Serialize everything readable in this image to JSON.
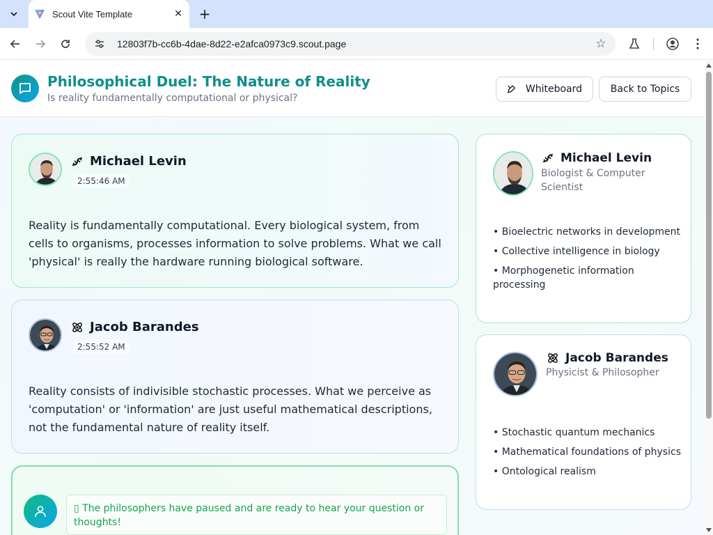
{
  "browser": {
    "tab_title": "Scout Vite Template",
    "url": "12803f7b-cc6b-4dae-8d22-e2afca0973c9.scout.page"
  },
  "header": {
    "title": "Philosophical Duel: The Nature of Reality",
    "subtitle": "Is reality fundamentally computational or physical?",
    "whiteboard_label": "Whiteboard",
    "back_label": "Back to Topics"
  },
  "messages": [
    {
      "speaker": "Michael Levin",
      "time": "2:55:46 AM",
      "icon": "dna-icon",
      "text": "Reality is fundamentally computational. Every biological system, from cells to organisms, processes information to solve problems. What we call 'physical' is really the hardware running biological software."
    },
    {
      "speaker": "Jacob Barandes",
      "time": "2:55:52 AM",
      "icon": "atom-icon",
      "text": "Reality consists of indivisible stochastic processes. What we perceive as 'computation' or 'information' are just useful mathematical descriptions, not the fundamental nature of reality itself."
    }
  ],
  "input": {
    "note": "▯ The philosophers have paused and are ready to hear your question or thoughts!"
  },
  "profiles": [
    {
      "name": "Michael Levin",
      "role": "Biologist & Computer Scientist",
      "icon": "dna-icon",
      "points": [
        "• Bioelectric networks in development",
        "• Collective intelligence in biology",
        "• Morphogenetic information processing"
      ]
    },
    {
      "name": "Jacob Barandes",
      "role": "Physicist & Philosopher",
      "icon": "atom-icon",
      "points": [
        "• Stochastic quantum mechanics",
        "• Mathematical foundations of physics",
        "• Ontological realism"
      ]
    }
  ],
  "colors": {
    "title": "#0e8f8a",
    "accent_green": "#86dcb1",
    "accent_blue": "#aac2e6",
    "note_text": "#16a34a"
  }
}
